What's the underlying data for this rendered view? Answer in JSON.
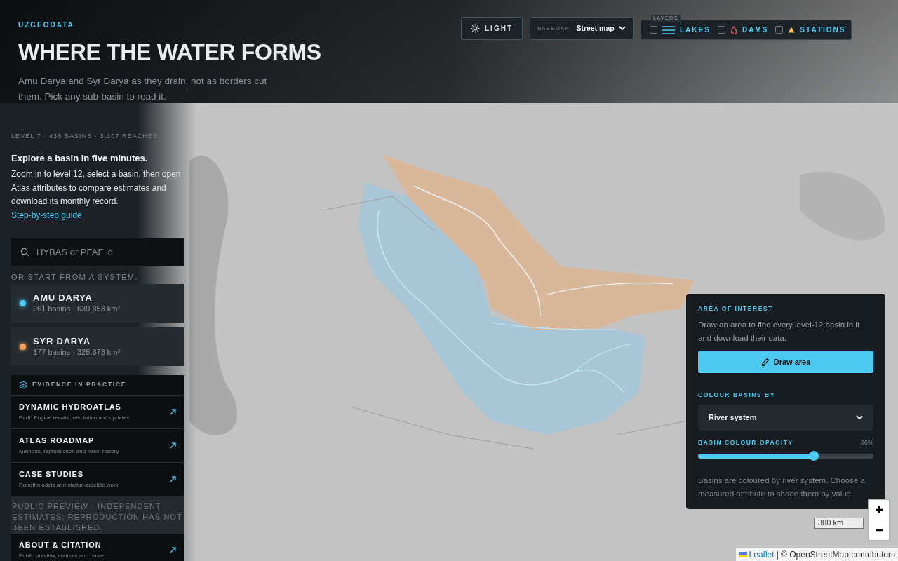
{
  "brand": "UZGEODATA",
  "title": "WHERE THE WATER FORMS",
  "subtitle": "Amu Darya and Syr Darya as they drain, not as borders cut them. Pick any sub-basin to read it.",
  "toolbar": {
    "theme_button": "LIGHT",
    "basemap": {
      "label": "BASEMAP",
      "value": "Street map"
    },
    "layers": {
      "legend": "LAYERS",
      "items": [
        {
          "kind": "lakes",
          "label": "LAKES",
          "checked": false
        },
        {
          "kind": "dams",
          "label": "DAMS",
          "checked": false
        },
        {
          "kind": "stations",
          "label": "STATIONS",
          "checked": false
        }
      ]
    }
  },
  "sidebar": {
    "stats": "LEVEL 7 · 438 BASINS · 3,107 REACHES",
    "intro_heading": "Explore a basin in five minutes.",
    "intro_text": "Zoom in to level 12, select a basin, then open Atlas attributes to compare estimates and download its monthly record.",
    "intro_link": "Step-by-step guide",
    "search": {
      "placeholder": "HYBAS or PFAF id"
    },
    "systems_label": "OR START FROM A SYSTEM.",
    "systems": [
      {
        "name": "AMU DARYA",
        "detail": "261 basins · 639,853 km²",
        "color": "#4cc9f0"
      },
      {
        "name": "SYR DARYA",
        "detail": "177 basins · 325,873 km²",
        "color": "#f4a261"
      }
    ],
    "evidence": {
      "heading": "EVIDENCE IN PRACTICE",
      "links": [
        {
          "title": "DYNAMIC HYDROATLAS",
          "subtitle": "Earth Engine results, resolution and updates"
        },
        {
          "title": "ATLAS ROADMAP",
          "subtitle": "Methods, reproduction and basin history"
        },
        {
          "title": "CASE STUDIES",
          "subtitle": "Runoff models and station-satellite work"
        }
      ]
    },
    "notice": "PUBLIC PREVIEW · INDEPENDENT ESTIMATES; REPRODUCTION HAS NOT BEEN ESTABLISHED.",
    "about": {
      "title": "ABOUT & CITATION",
      "subtitle": "Public preview, sources and reuse"
    }
  },
  "panel": {
    "aoi_heading": "AREA OF INTEREST",
    "aoi_text": "Draw an area to find every level-12 basin in it and download their data.",
    "draw_button": "Draw area",
    "colour_by_label": "COLOUR BASINS BY",
    "colour_by_value": "River system",
    "opacity": {
      "label": "BASIN COLOUR OPACITY",
      "reading": "66%",
      "level": 0.66
    },
    "footnote": "Basins are coloured by river system. Choose a measured attribute to shade them by value."
  },
  "map": {
    "scale": "300 km",
    "zoom_in": "+",
    "zoom_out": "−",
    "attribution_link": "Leaflet",
    "attribution_text": "| © OpenStreetMap contributors"
  }
}
